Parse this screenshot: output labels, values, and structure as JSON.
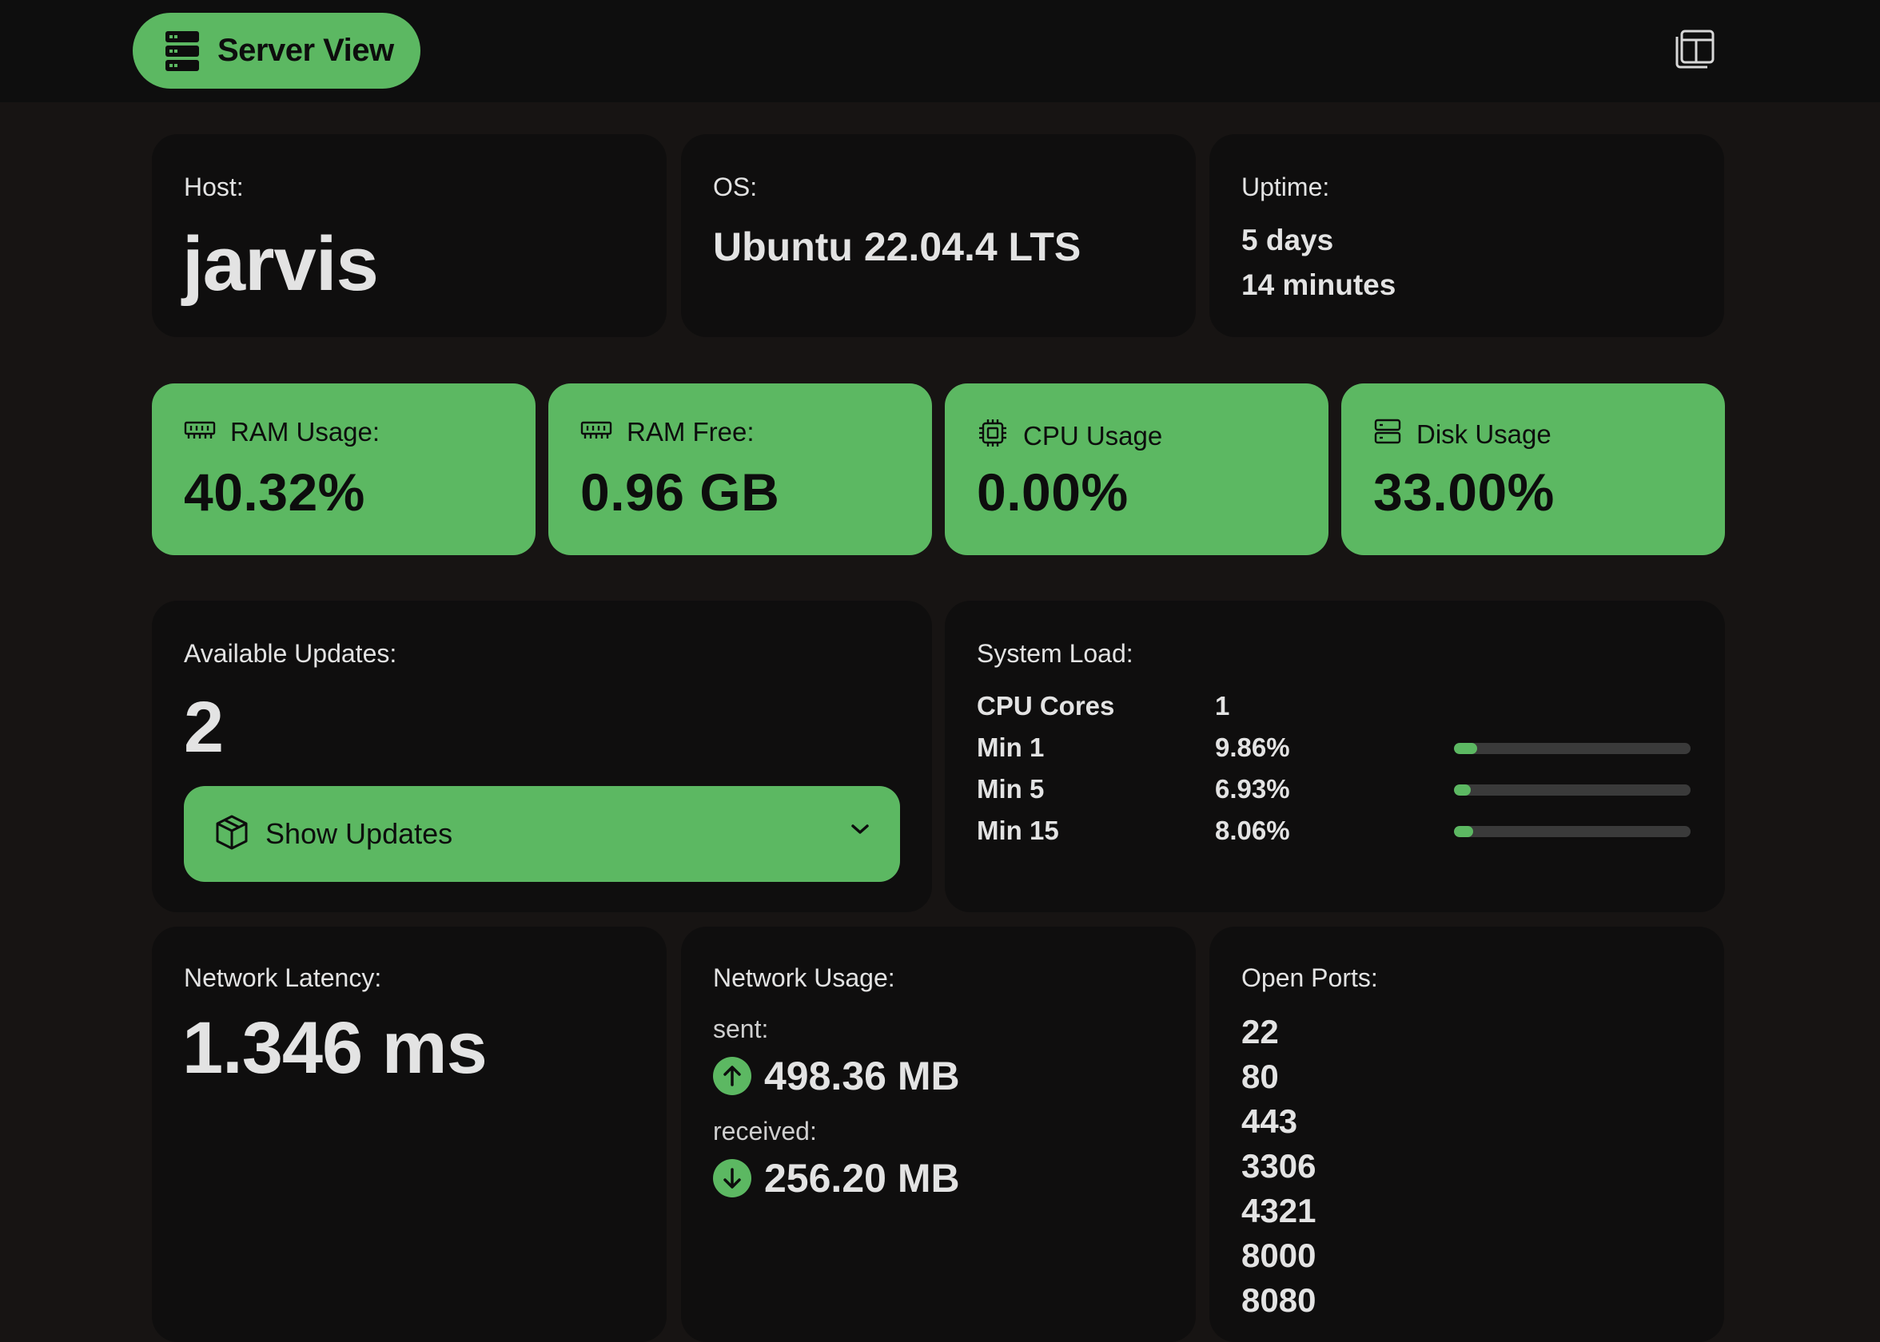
{
  "header": {
    "brand_label": "Server View",
    "brand_icon": "server-icon",
    "window_icon": "windows-icon"
  },
  "info": {
    "host_label": "Host:",
    "host_value": "jarvis",
    "os_label": "OS:",
    "os_value": "Ubuntu 22.04.4 LTS",
    "uptime_label": "Uptime:",
    "uptime_line1": "5 days",
    "uptime_line2": "14 minutes"
  },
  "stats": {
    "ram_usage_label": "RAM Usage:",
    "ram_usage_value": "40.32%",
    "ram_free_label": "RAM Free:",
    "ram_free_value": "0.96 GB",
    "cpu_usage_label": "CPU Usage",
    "cpu_usage_value": "0.00%",
    "disk_usage_label": "Disk Usage",
    "disk_usage_value": "33.00%"
  },
  "updates": {
    "label": "Available Updates:",
    "count": "2",
    "button_label": "Show Updates"
  },
  "load": {
    "label": "System Load:",
    "cores_label": "CPU Cores",
    "cores_value": "1",
    "rows": [
      {
        "label": "Min 1",
        "value": "9.86%",
        "fraction": 0.0986
      },
      {
        "label": "Min 5",
        "value": "6.93%",
        "fraction": 0.0693
      },
      {
        "label": "Min 15",
        "value": "8.06%",
        "fraction": 0.0806
      }
    ]
  },
  "latency": {
    "label": "Network Latency:",
    "value": "1.346 ms"
  },
  "network": {
    "label": "Network Usage:",
    "sent_label": "sent:",
    "sent_value": "498.36 MB",
    "received_label": "received:",
    "received_value": "256.20 MB"
  },
  "ports": {
    "label": "Open Ports:",
    "list": [
      "22",
      "80",
      "443",
      "3306",
      "4321",
      "8000",
      "8080"
    ]
  },
  "colors": {
    "accent": "#5cb862",
    "card_bg": "#0f0e0e",
    "page_bg": "#171413"
  }
}
